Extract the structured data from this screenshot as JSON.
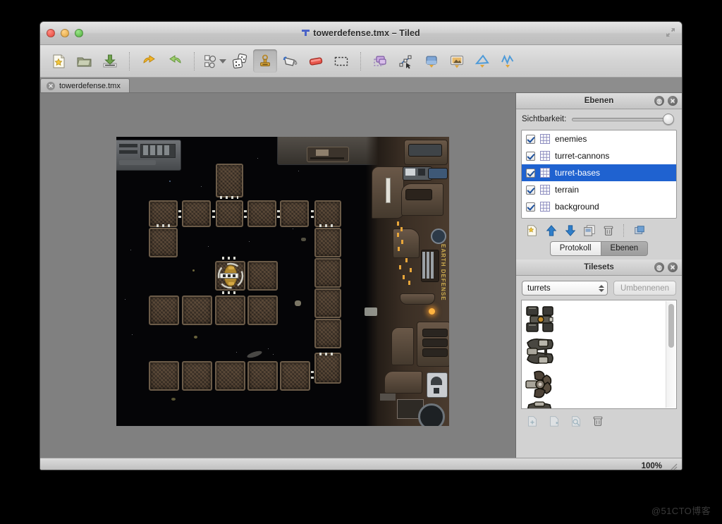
{
  "window": {
    "title": "towerdefense.tmx – Tiled",
    "title_icon": "tiled-logo-icon",
    "traffic_lights": [
      "close",
      "minimize",
      "maximize"
    ],
    "expand_icon": "fullscreen-arrows-icon"
  },
  "toolbar": {
    "buttons": [
      {
        "name": "new-map-button",
        "icon": "new-document-star-icon",
        "active": false
      },
      {
        "name": "open-file-button",
        "icon": "open-folder-icon",
        "active": false
      },
      {
        "name": "save-file-button",
        "icon": "save-download-icon",
        "active": false
      },
      {
        "name": "undo-button",
        "icon": "undo-arrow-icon",
        "active": false
      },
      {
        "name": "redo-button",
        "icon": "redo-arrow-icon",
        "active": false
      },
      {
        "name": "stamp-brush-dropdown-button",
        "icon": "stamp-variations-icon",
        "active": false
      },
      {
        "name": "random-mode-button",
        "icon": "dice-icon",
        "active": false
      },
      {
        "name": "stamp-tool-button",
        "icon": "stamp-tool-icon",
        "active": true
      },
      {
        "name": "fill-tool-button",
        "icon": "paint-bucket-icon",
        "active": false
      },
      {
        "name": "eraser-tool-button",
        "icon": "eraser-icon",
        "active": false
      },
      {
        "name": "select-rectangle-button",
        "icon": "marquee-select-icon",
        "active": false
      },
      {
        "name": "select-objects-button",
        "icon": "select-objects-icon",
        "active": false
      },
      {
        "name": "edit-polygons-button",
        "icon": "edit-polygon-icon",
        "active": false
      },
      {
        "name": "insert-tile-button",
        "icon": "insert-tile-icon",
        "active": false
      },
      {
        "name": "insert-image-button",
        "icon": "insert-image-icon",
        "active": false
      },
      {
        "name": "insert-polygon-button",
        "icon": "insert-polygon-icon",
        "active": false
      },
      {
        "name": "insert-polyline-button",
        "icon": "insert-polyline-icon",
        "active": false
      }
    ]
  },
  "document_tabs": [
    {
      "label": "towerdefense.tmx",
      "close_icon": "close-circle-icon",
      "active": true
    }
  ],
  "layers_panel": {
    "header_title": "Ebenen",
    "header_buttons": [
      {
        "name": "float-panel-button",
        "icon": "undock-icon"
      },
      {
        "name": "close-panel-button",
        "icon": "close-icon"
      }
    ],
    "visibility_label": "Sichtbarkeit:",
    "visibility_value": "100",
    "layers": [
      {
        "name": "enemies",
        "visible": true,
        "selected": false
      },
      {
        "name": "turret-cannons",
        "visible": true,
        "selected": false
      },
      {
        "name": "turret-bases",
        "visible": true,
        "selected": true
      },
      {
        "name": "terrain",
        "visible": true,
        "selected": false
      },
      {
        "name": "background",
        "visible": true,
        "selected": false
      }
    ],
    "tools": [
      {
        "name": "new-layer-button",
        "icon": "new-layer-icon"
      },
      {
        "name": "raise-layer-button",
        "icon": "arrow-up-icon"
      },
      {
        "name": "lower-layer-button",
        "icon": "arrow-down-icon"
      },
      {
        "name": "duplicate-layer-button",
        "icon": "duplicate-layer-icon"
      },
      {
        "name": "delete-layer-button",
        "icon": "trash-can-icon"
      },
      {
        "name": "layer-properties-button",
        "icon": "layer-properties-icon"
      }
    ],
    "tabs": [
      {
        "label": "Protokoll",
        "active": false
      },
      {
        "label": "Ebenen",
        "active": true
      }
    ]
  },
  "tilesets_panel": {
    "header_title": "Tilesets",
    "header_buttons": [
      {
        "name": "float-panel-button",
        "icon": "undock-icon"
      },
      {
        "name": "close-panel-button",
        "icon": "close-icon"
      }
    ],
    "selected_tileset": "turrets",
    "rename_button_label": "Umbennenen",
    "tiles": [
      {
        "name": "turret-tile-1",
        "icon": "turret-cannon-sprite"
      },
      {
        "name": "turret-tile-2",
        "icon": "turret-armored-sprite"
      },
      {
        "name": "turret-tile-3",
        "icon": "turret-gear-sprite"
      },
      {
        "name": "turret-tile-4",
        "icon": "turret-partial-sprite"
      }
    ],
    "tools": [
      {
        "name": "new-tileset-button",
        "icon": "new-tileset-icon",
        "enabled": false
      },
      {
        "name": "import-tileset-button",
        "icon": "import-tileset-icon",
        "enabled": false
      },
      {
        "name": "edit-tileset-button",
        "icon": "edit-tileset-icon",
        "enabled": false
      },
      {
        "name": "remove-tileset-button",
        "icon": "trash-can-icon",
        "enabled": true
      }
    ]
  },
  "statusbar": {
    "zoom_level": "100%",
    "resize_grip_icon": "resize-grip-icon"
  },
  "map_canvas": {
    "background_label": "EARTH DEFENSE",
    "placed_turret": "turret-base-sprite"
  },
  "watermark": "@51CTO博客",
  "colors": {
    "selection_blue": "#1f62d0",
    "window_chrome": "#d2d2d2",
    "canvas_backdrop": "#808080",
    "map_space": "#050507",
    "tile_border": "#6b5b48",
    "station_metal": "#4a3b2e",
    "accent_amber": "#c9a84e"
  }
}
